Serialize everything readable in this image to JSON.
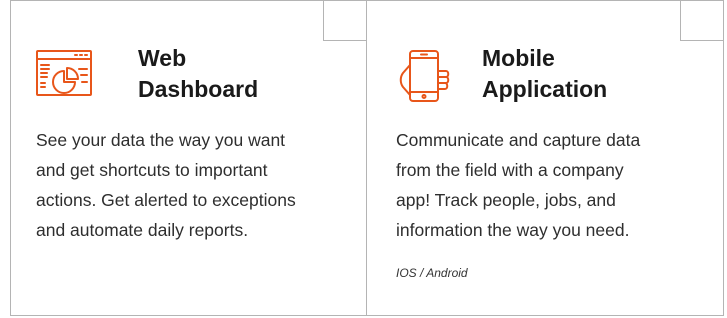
{
  "cards": [
    {
      "title_lines": [
        "Web",
        "Dashboard"
      ],
      "description_lines": [
        "See your data the way you want",
        "and get shortcuts to important",
        "actions. Get alerted to exceptions",
        "and automate daily reports."
      ],
      "icon": "browser-chart-icon"
    },
    {
      "title_lines": [
        "Mobile",
        "Application"
      ],
      "description_lines": [
        "Communicate and capture data",
        "from the field with a company",
        "app! Track people, jobs, and",
        "information the way you need."
      ],
      "platforms": "IOS / Android",
      "icon": "hand-phone-icon"
    }
  ],
  "colors": {
    "accent": "#e8561a",
    "border": "#b4b4b4",
    "text": "#2e2e2e"
  }
}
